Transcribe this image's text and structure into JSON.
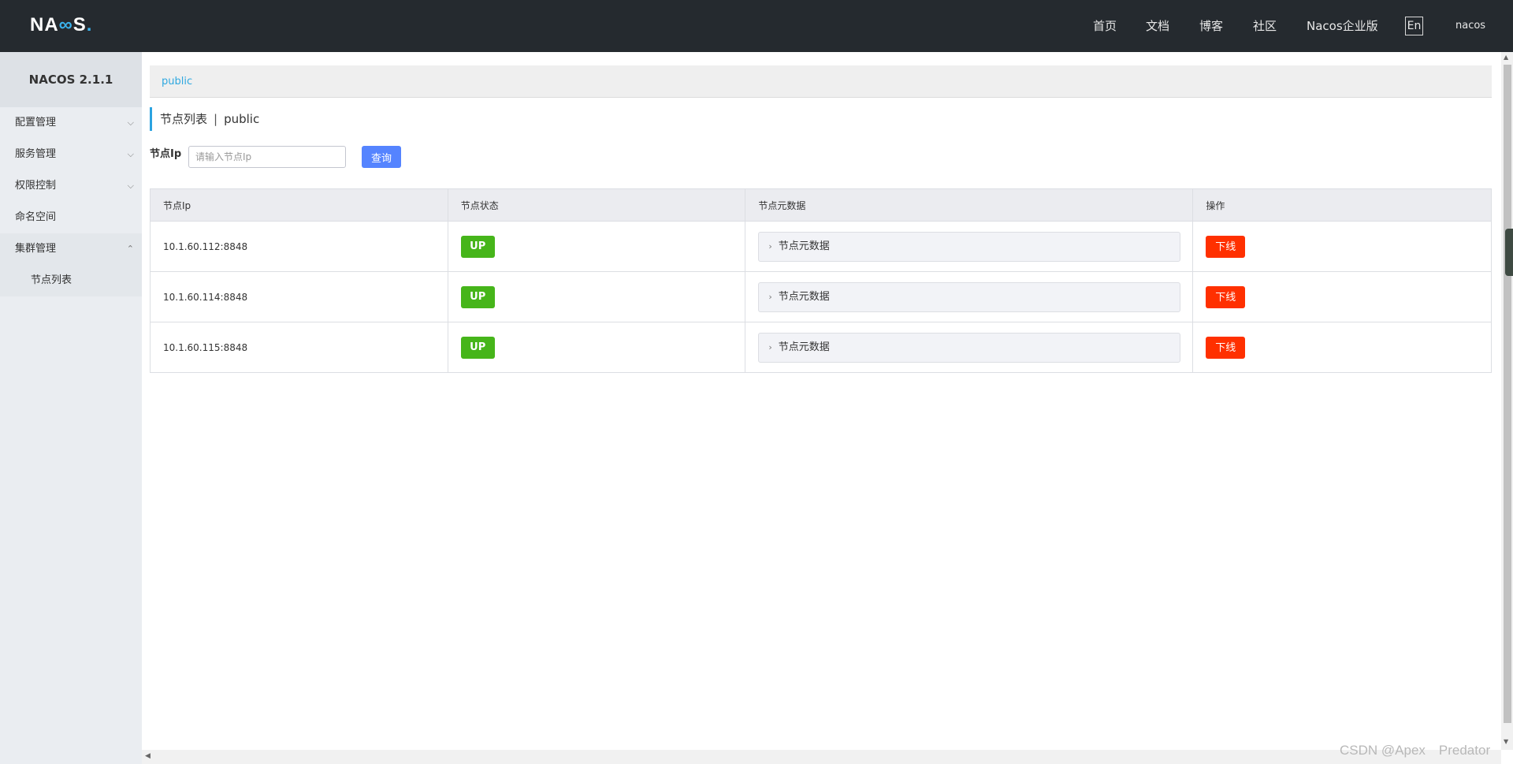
{
  "header": {
    "logo_text": "NACOS",
    "nav": [
      "首页",
      "文档",
      "博客",
      "社区",
      "Nacos企业版"
    ],
    "lang_label": "En",
    "user": "nacos"
  },
  "sidebar": {
    "title": "NACOS 2.1.1",
    "items": [
      {
        "label": "配置管理",
        "chevron": "down"
      },
      {
        "label": "服务管理",
        "chevron": "down"
      },
      {
        "label": "权限控制",
        "chevron": "down"
      },
      {
        "label": "命名空间",
        "chevron": ""
      },
      {
        "label": "集群管理",
        "chevron": "up"
      }
    ],
    "sub_item": "节点列表"
  },
  "namespace": {
    "current": "public"
  },
  "page": {
    "title": "节点列表",
    "separator": "|",
    "namespace": "public"
  },
  "search": {
    "label": "节点Ip",
    "placeholder": "请输入节点Ip",
    "button": "查询"
  },
  "table": {
    "columns": [
      "节点Ip",
      "节点状态",
      "节点元数据",
      "操作"
    ],
    "rows": [
      {
        "ip": "10.1.60.112:8848",
        "status": "UP",
        "meta": "节点元数据",
        "action": "下线"
      },
      {
        "ip": "10.1.60.114:8848",
        "status": "UP",
        "meta": "节点元数据",
        "action": "下线"
      },
      {
        "ip": "10.1.60.115:8848",
        "status": "UP",
        "meta": "节点元数据",
        "action": "下线"
      }
    ]
  },
  "watermark": "CSDN @Apex　Predator",
  "colors": {
    "header_bg": "#252a2f",
    "primary": "#5584ff",
    "up": "#46b51a",
    "danger": "#ff3000",
    "accent": "#2ba3e0"
  }
}
